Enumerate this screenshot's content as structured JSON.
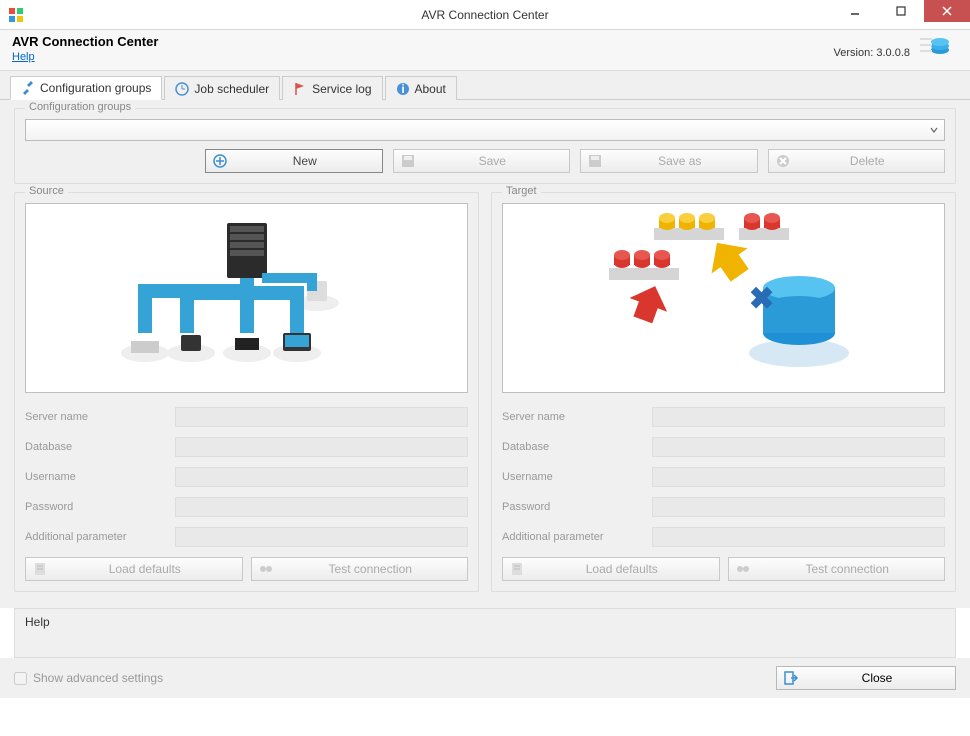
{
  "window": {
    "title": "AVR Connection Center"
  },
  "header": {
    "app_title": "AVR Connection Center",
    "help_link": "Help",
    "version": "Version: 3.0.0.8"
  },
  "tabs": [
    {
      "label": "Configuration groups",
      "icon": "tools-icon",
      "active": true
    },
    {
      "label": "Job scheduler",
      "icon": "clock-icon",
      "active": false
    },
    {
      "label": "Service log",
      "icon": "flag-icon",
      "active": false
    },
    {
      "label": "About",
      "icon": "info-icon",
      "active": false
    }
  ],
  "groupbox": {
    "legend": "Configuration groups",
    "dropdown_value": ""
  },
  "toolbar": {
    "new": "New",
    "save": "Save",
    "save_as": "Save as",
    "delete": "Delete"
  },
  "panels": {
    "source": {
      "legend": "Source",
      "fields": {
        "server_name": "Server name",
        "database": "Database",
        "username": "Username",
        "password": "Password",
        "additional_parameter": "Additional parameter"
      },
      "values": {
        "server_name": "",
        "database": "",
        "username": "",
        "password": "",
        "additional_parameter": ""
      },
      "buttons": {
        "load_defaults": "Load defaults",
        "test_connection": "Test connection"
      }
    },
    "target": {
      "legend": "Target",
      "fields": {
        "server_name": "Server name",
        "database": "Database",
        "username": "Username",
        "password": "Password",
        "additional_parameter": "Additional parameter"
      },
      "values": {
        "server_name": "",
        "database": "",
        "username": "",
        "password": "",
        "additional_parameter": ""
      },
      "buttons": {
        "load_defaults": "Load defaults",
        "test_connection": "Test connection"
      }
    }
  },
  "help_area": {
    "title": "Help"
  },
  "footer": {
    "show_advanced": "Show advanced settings",
    "close": "Close"
  },
  "colors": {
    "accent_blue": "#35a3d6",
    "close_red": "#c75050",
    "disabled_grey": "#aaaaaa"
  }
}
